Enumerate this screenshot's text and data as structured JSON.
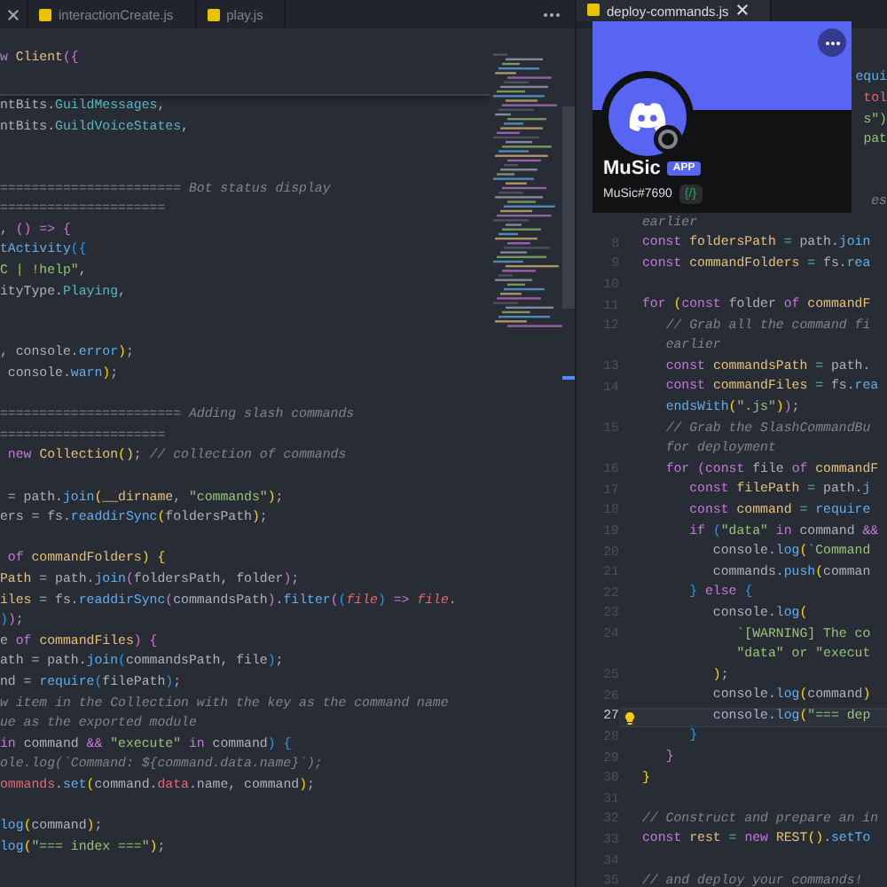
{
  "left_pane": {
    "tabs": [
      {
        "label": "interactionCreate.js",
        "selected": false
      },
      {
        "label": "play.js",
        "selected": false
      }
    ],
    "sticky_line": {
      "tokens": [
        {
          "t": "w ",
          "kind": "kw"
        },
        {
          "t": "Client",
          "kind": "var"
        },
        {
          "t": "({",
          "kind": "b2"
        }
      ]
    },
    "lines": [
      {
        "kind": "code",
        "tokens": [
          {
            "t": "ntBits.",
            "kind": "pl"
          },
          {
            "t": "GuildMessages",
            "kind": "mem"
          },
          {
            "t": ",",
            "kind": "pl"
          }
        ]
      },
      {
        "kind": "code",
        "tokens": [
          {
            "t": "ntBits.",
            "kind": "pl"
          },
          {
            "t": "GuildVoiceStates",
            "kind": "mem"
          },
          {
            "t": ",",
            "kind": "pl"
          }
        ]
      },
      {
        "kind": "blank"
      },
      {
        "kind": "blank"
      },
      {
        "kind": "code",
        "tokens": [
          {
            "t": "======================= Bot status display",
            "kind": "com"
          }
        ]
      },
      {
        "kind": "code",
        "tokens": [
          {
            "t": "=====================",
            "kind": "com"
          }
        ]
      },
      {
        "kind": "code",
        "tokens": [
          {
            "t": ", ",
            "kind": "pl"
          },
          {
            "t": "()",
            "kind": "b2"
          },
          {
            "t": " => ",
            "kind": "kw"
          },
          {
            "t": "{",
            "kind": "b2"
          }
        ]
      },
      {
        "kind": "code",
        "tokens": [
          {
            "t": "tActivity",
            "kind": "fn"
          },
          {
            "t": "({",
            "kind": "b3"
          }
        ]
      },
      {
        "kind": "code",
        "tokens": [
          {
            "t": "C | !help\"",
            "kind": "str"
          },
          {
            "t": ",",
            "kind": "pl"
          }
        ]
      },
      {
        "kind": "code",
        "tokens": [
          {
            "t": "ityType.",
            "kind": "pl"
          },
          {
            "t": "Playing",
            "kind": "mem"
          },
          {
            "t": ",",
            "kind": "pl"
          }
        ]
      },
      {
        "kind": "blank"
      },
      {
        "kind": "blank"
      },
      {
        "kind": "code",
        "tokens": [
          {
            "t": ", console.",
            "kind": "pl"
          },
          {
            "t": "error",
            "kind": "fn"
          },
          {
            "t": ")",
            "kind": "b1"
          },
          {
            "t": ";",
            "kind": "pl"
          }
        ]
      },
      {
        "kind": "code",
        "tokens": [
          {
            "t": " console.",
            "kind": "pl"
          },
          {
            "t": "warn",
            "kind": "fn"
          },
          {
            "t": ")",
            "kind": "b1"
          },
          {
            "t": ";",
            "kind": "pl"
          }
        ]
      },
      {
        "kind": "blank"
      },
      {
        "kind": "code",
        "tokens": [
          {
            "t": "======================= Adding slash commands",
            "kind": "com"
          }
        ]
      },
      {
        "kind": "code",
        "tokens": [
          {
            "t": "=====================",
            "kind": "com"
          }
        ]
      },
      {
        "kind": "code",
        "tokens": [
          {
            "t": " new ",
            "kind": "kw"
          },
          {
            "t": "Collection",
            "kind": "var"
          },
          {
            "t": "()",
            "kind": "b1"
          },
          {
            "t": "; ",
            "kind": "pl"
          },
          {
            "t": "// collection of commands",
            "kind": "com"
          }
        ]
      },
      {
        "kind": "blank"
      },
      {
        "kind": "code",
        "tokens": [
          {
            "t": " = path.",
            "kind": "pl"
          },
          {
            "t": "join",
            "kind": "fn"
          },
          {
            "t": "(",
            "kind": "b1"
          },
          {
            "t": "__dirname",
            "kind": "var"
          },
          {
            "t": ", ",
            "kind": "pl"
          },
          {
            "t": "\"commands\"",
            "kind": "str"
          },
          {
            "t": ")",
            "kind": "b1"
          },
          {
            "t": ";",
            "kind": "pl"
          }
        ]
      },
      {
        "kind": "code",
        "tokens": [
          {
            "t": "ers = fs.",
            "kind": "pl"
          },
          {
            "t": "readdirSync",
            "kind": "fn"
          },
          {
            "t": "(",
            "kind": "b1"
          },
          {
            "t": "foldersPath",
            "kind": "pl"
          },
          {
            "t": ")",
            "kind": "b1"
          },
          {
            "t": ";",
            "kind": "pl"
          }
        ]
      },
      {
        "kind": "blank"
      },
      {
        "kind": "code",
        "tokens": [
          {
            "t": " of ",
            "kind": "kw"
          },
          {
            "t": "commandFolders",
            "kind": "var"
          },
          {
            "t": ") {",
            "kind": "b1"
          }
        ]
      },
      {
        "kind": "code",
        "tokens": [
          {
            "t": "Path",
            "kind": "var"
          },
          {
            "t": " = path.",
            "kind": "pl"
          },
          {
            "t": "join",
            "kind": "fn"
          },
          {
            "t": "(",
            "kind": "b2"
          },
          {
            "t": "foldersPath, folder",
            "kind": "pl"
          },
          {
            "t": ")",
            "kind": "b2"
          },
          {
            "t": ";",
            "kind": "pl"
          }
        ]
      },
      {
        "kind": "code",
        "tokens": [
          {
            "t": "iles",
            "kind": "var"
          },
          {
            "t": " = fs.",
            "kind": "pl"
          },
          {
            "t": "readdirSync",
            "kind": "fn"
          },
          {
            "t": "(",
            "kind": "b2"
          },
          {
            "t": "commandsPath",
            "kind": "pl"
          },
          {
            "t": ")",
            "kind": "b2"
          },
          {
            "t": ".",
            "kind": "pl"
          },
          {
            "t": "filter",
            "kind": "fn"
          },
          {
            "t": "(",
            "kind": "b2"
          },
          {
            "t": "(",
            "kind": "b3"
          },
          {
            "t": "file",
            "kind": "par"
          },
          {
            "t": ")",
            "kind": "b3"
          },
          {
            "t": " => ",
            "kind": "kw"
          },
          {
            "t": "file",
            "kind": "par"
          },
          {
            "t": ".",
            "kind": "pl"
          }
        ]
      },
      {
        "kind": "code",
        "tokens": [
          {
            "t": ")",
            "kind": "b3"
          },
          {
            "t": ")",
            "kind": "b2"
          },
          {
            "t": ";",
            "kind": "pl"
          }
        ]
      },
      {
        "kind": "code",
        "tokens": [
          {
            "t": "e ",
            "kind": "pl"
          },
          {
            "t": "of ",
            "kind": "kw"
          },
          {
            "t": "commandFiles",
            "kind": "var"
          },
          {
            "t": ") {",
            "kind": "b2"
          }
        ]
      },
      {
        "kind": "code",
        "tokens": [
          {
            "t": "ath = path.",
            "kind": "pl"
          },
          {
            "t": "join",
            "kind": "fn"
          },
          {
            "t": "(",
            "kind": "b3"
          },
          {
            "t": "commandsPath, file",
            "kind": "pl"
          },
          {
            "t": ")",
            "kind": "b3"
          },
          {
            "t": ";",
            "kind": "pl"
          }
        ]
      },
      {
        "kind": "code",
        "tokens": [
          {
            "t": "nd = ",
            "kind": "pl"
          },
          {
            "t": "require",
            "kind": "fn"
          },
          {
            "t": "(",
            "kind": "b3"
          },
          {
            "t": "filePath",
            "kind": "pl"
          },
          {
            "t": ")",
            "kind": "b3"
          },
          {
            "t": ";",
            "kind": "pl"
          }
        ]
      },
      {
        "kind": "code",
        "tokens": [
          {
            "t": "w item in the Collection with the key as the command name",
            "kind": "com"
          }
        ]
      },
      {
        "kind": "code",
        "tokens": [
          {
            "t": "ue as the exported module",
            "kind": "com"
          }
        ]
      },
      {
        "kind": "code",
        "tokens": [
          {
            "t": "in ",
            "kind": "kw"
          },
          {
            "t": "command ",
            "kind": "pl"
          },
          {
            "t": "&& ",
            "kind": "kw"
          },
          {
            "t": "\"execute\"",
            "kind": "str"
          },
          {
            "t": " in ",
            "kind": "kw"
          },
          {
            "t": "command",
            "kind": "pl"
          },
          {
            "t": ") {",
            "kind": "b3"
          }
        ]
      },
      {
        "kind": "code",
        "tokens": [
          {
            "t": "ole.log(`Command: ${command.data.name}`);",
            "kind": "com"
          }
        ]
      },
      {
        "kind": "code",
        "tokens": [
          {
            "t": "ommands",
            "kind": "prop"
          },
          {
            "t": ".",
            "kind": "pl"
          },
          {
            "t": "set",
            "kind": "fn"
          },
          {
            "t": "(",
            "kind": "b1"
          },
          {
            "t": "command.",
            "kind": "pl"
          },
          {
            "t": "data",
            "kind": "prop"
          },
          {
            "t": ".name, command",
            "kind": "pl"
          },
          {
            "t": ")",
            "kind": "b1"
          },
          {
            "t": ";",
            "kind": "pl"
          }
        ]
      },
      {
        "kind": "blank"
      },
      {
        "kind": "code",
        "tokens": [
          {
            "t": "log",
            "kind": "fn"
          },
          {
            "t": "(",
            "kind": "b1"
          },
          {
            "t": "command",
            "kind": "pl"
          },
          {
            "t": ")",
            "kind": "b1"
          },
          {
            "t": ";",
            "kind": "pl"
          }
        ]
      },
      {
        "kind": "code",
        "tokens": [
          {
            "t": "log",
            "kind": "fn"
          },
          {
            "t": "(",
            "kind": "b1"
          },
          {
            "t": "\"=== index ===\"",
            "kind": "str"
          },
          {
            "t": ")",
            "kind": "b1"
          },
          {
            "t": ";",
            "kind": "pl"
          }
        ]
      }
    ]
  },
  "right_pane": {
    "tabs": [
      {
        "label": "deploy-commands.js",
        "selected": true
      }
    ],
    "lines": [
      {
        "kind": "covered"
      },
      {
        "kind": "covered"
      },
      {
        "kind": "clipped",
        "tokens": [
          {
            "t": "equi",
            "kind": "fn"
          }
        ]
      },
      {
        "kind": "clipped",
        "tokens": [
          {
            "t": "tol",
            "kind": "prop"
          }
        ]
      },
      {
        "kind": "clipped",
        "tokens": [
          {
            "t": "s\")",
            "kind": "str"
          }
        ]
      },
      {
        "kind": "clipped",
        "tokens": [
          {
            "t": "pat",
            "kind": "str"
          }
        ]
      },
      {
        "kind": "covered"
      },
      {
        "kind": "covered"
      },
      {
        "kind": "clipped",
        "tokens": [
          {
            "t": "es",
            "kind": "com"
          }
        ]
      },
      {
        "kind": "wrap",
        "tokens": [
          {
            "t": "earlier",
            "kind": "com"
          }
        ]
      },
      {
        "kind": "code",
        "number": "8",
        "current": false,
        "tokens": [
          {
            "t": "const ",
            "kind": "kw"
          },
          {
            "t": "foldersPath",
            "kind": "var"
          },
          {
            "t": " = ",
            "kind": "mem"
          },
          {
            "t": "path.",
            "kind": "pl"
          },
          {
            "t": "join",
            "kind": "fn"
          }
        ]
      },
      {
        "kind": "code",
        "number": "9",
        "current": false,
        "tokens": [
          {
            "t": "const ",
            "kind": "kw"
          },
          {
            "t": "commandFolders",
            "kind": "var"
          },
          {
            "t": " = ",
            "kind": "mem"
          },
          {
            "t": "fs.",
            "kind": "pl"
          },
          {
            "t": "rea",
            "kind": "fn"
          }
        ]
      },
      {
        "kind": "blank",
        "number": "10",
        "current": false
      },
      {
        "kind": "code",
        "number": "11",
        "current": false,
        "tokens": [
          {
            "t": "for ",
            "kind": "kw"
          },
          {
            "t": "(",
            "kind": "b1"
          },
          {
            "t": "const ",
            "kind": "kw"
          },
          {
            "t": "folder ",
            "kind": "pl"
          },
          {
            "t": "of ",
            "kind": "kw"
          },
          {
            "t": "commandF",
            "kind": "var"
          }
        ]
      },
      {
        "kind": "code",
        "number": "12",
        "current": false,
        "tokens": [
          {
            "t": "\t// Grab all the command fi",
            "kind": "com"
          }
        ]
      },
      {
        "kind": "wrap",
        "tokens": [
          {
            "t": "\tearlier",
            "kind": "com"
          }
        ]
      },
      {
        "kind": "code",
        "number": "13",
        "current": false,
        "tokens": [
          {
            "t": "\tconst ",
            "kind": "kw"
          },
          {
            "t": "commandsPath",
            "kind": "var"
          },
          {
            "t": " = ",
            "kind": "mem"
          },
          {
            "t": "path.",
            "kind": "pl"
          }
        ]
      },
      {
        "kind": "code",
        "number": "14",
        "current": false,
        "tokens": [
          {
            "t": "\tconst ",
            "kind": "kw"
          },
          {
            "t": "commandFiles",
            "kind": "var"
          },
          {
            "t": " = ",
            "kind": "mem"
          },
          {
            "t": "fs.",
            "kind": "pl"
          },
          {
            "t": "rea",
            "kind": "fn"
          }
        ]
      },
      {
        "kind": "wrap",
        "tokens": [
          {
            "t": "\tendsWith",
            "kind": "fn"
          },
          {
            "t": "(",
            "kind": "b1"
          },
          {
            "t": "\".js\"",
            "kind": "str"
          },
          {
            "t": ")",
            "kind": "b1"
          },
          {
            "t": ")",
            "kind": "b2"
          },
          {
            "t": ";",
            "kind": "pl"
          }
        ]
      },
      {
        "kind": "code",
        "number": "15",
        "current": false,
        "tokens": [
          {
            "t": "\t// Grab the SlashCommandBu",
            "kind": "com"
          }
        ]
      },
      {
        "kind": "wrap",
        "tokens": [
          {
            "t": "\tfor deployment",
            "kind": "com"
          }
        ]
      },
      {
        "kind": "code",
        "number": "16",
        "current": false,
        "tokens": [
          {
            "t": "\tfor ",
            "kind": "kw"
          },
          {
            "t": "(",
            "kind": "b2"
          },
          {
            "t": "const ",
            "kind": "kw"
          },
          {
            "t": "file ",
            "kind": "pl"
          },
          {
            "t": "of ",
            "kind": "kw"
          },
          {
            "t": "commandF",
            "kind": "var"
          }
        ]
      },
      {
        "kind": "code",
        "number": "17",
        "current": false,
        "tokens": [
          {
            "t": "\t\tconst ",
            "kind": "kw"
          },
          {
            "t": "filePath",
            "kind": "var"
          },
          {
            "t": " = ",
            "kind": "mem"
          },
          {
            "t": "path.",
            "kind": "pl"
          },
          {
            "t": "j",
            "kind": "fn"
          }
        ]
      },
      {
        "kind": "code",
        "number": "18",
        "current": false,
        "tokens": [
          {
            "t": "\t\tconst ",
            "kind": "kw"
          },
          {
            "t": "command",
            "kind": "var"
          },
          {
            "t": " = ",
            "kind": "mem"
          },
          {
            "t": "require",
            "kind": "fn"
          }
        ]
      },
      {
        "kind": "code",
        "number": "19",
        "current": false,
        "tokens": [
          {
            "t": "\t\tif ",
            "kind": "kw"
          },
          {
            "t": "(",
            "kind": "b3"
          },
          {
            "t": "\"data\"",
            "kind": "str"
          },
          {
            "t": " in ",
            "kind": "kw"
          },
          {
            "t": "command ",
            "kind": "pl"
          },
          {
            "t": "&&",
            "kind": "kw"
          }
        ]
      },
      {
        "kind": "code",
        "number": "20",
        "current": false,
        "tokens": [
          {
            "t": "\t\t\tconsole.",
            "kind": "pl"
          },
          {
            "t": "log",
            "kind": "fn"
          },
          {
            "t": "(",
            "kind": "b1"
          },
          {
            "t": "`Command",
            "kind": "str"
          }
        ]
      },
      {
        "kind": "code",
        "number": "21",
        "current": false,
        "tokens": [
          {
            "t": "\t\t\tcommands.",
            "kind": "pl"
          },
          {
            "t": "push",
            "kind": "fn"
          },
          {
            "t": "(",
            "kind": "b1"
          },
          {
            "t": "comman",
            "kind": "pl"
          }
        ]
      },
      {
        "kind": "code",
        "number": "22",
        "current": false,
        "tokens": [
          {
            "t": "\t\t}",
            "kind": "b3"
          },
          {
            "t": " else ",
            "kind": "kw"
          },
          {
            "t": "{",
            "kind": "b3"
          }
        ]
      },
      {
        "kind": "code",
        "number": "23",
        "current": false,
        "tokens": [
          {
            "t": "\t\t\tconsole.",
            "kind": "pl"
          },
          {
            "t": "log",
            "kind": "fn"
          },
          {
            "t": "(",
            "kind": "b1"
          }
        ]
      },
      {
        "kind": "code",
        "number": "24",
        "current": false,
        "tokens": [
          {
            "t": "\t\t\t\t`[WARNING] The co",
            "kind": "str"
          }
        ]
      },
      {
        "kind": "wrap",
        "tokens": [
          {
            "t": "\t\t\t\t\"data\" or \"execut",
            "kind": "str"
          }
        ]
      },
      {
        "kind": "code",
        "number": "25",
        "current": false,
        "tokens": [
          {
            "t": "\t\t\t)",
            "kind": "b1"
          },
          {
            "t": ";",
            "kind": "pl"
          }
        ]
      },
      {
        "kind": "code",
        "number": "26",
        "current": false,
        "tokens": [
          {
            "t": "\t\t\tconsole.",
            "kind": "pl"
          },
          {
            "t": "log",
            "kind": "fn"
          },
          {
            "t": "(",
            "kind": "b1"
          },
          {
            "t": "command",
            "kind": "pl"
          },
          {
            "t": ")",
            "kind": "b1"
          }
        ]
      },
      {
        "kind": "code",
        "number": "27",
        "current": true,
        "tokens": [
          {
            "t": "\t\t\tconsole.",
            "kind": "pl"
          },
          {
            "t": "log",
            "kind": "fn"
          },
          {
            "t": "(",
            "kind": "b1"
          },
          {
            "t": "\"=== dep",
            "kind": "str"
          }
        ]
      },
      {
        "kind": "code",
        "number": "28",
        "current": false,
        "tokens": [
          {
            "t": "\t\t}",
            "kind": "b3"
          }
        ]
      },
      {
        "kind": "code",
        "number": "29",
        "current": false,
        "tokens": [
          {
            "t": "\t}",
            "kind": "b2"
          }
        ]
      },
      {
        "kind": "code",
        "number": "30",
        "current": false,
        "tokens": [
          {
            "t": "}",
            "kind": "b1"
          }
        ]
      },
      {
        "kind": "blank",
        "number": "31",
        "current": false
      },
      {
        "kind": "code",
        "number": "32",
        "current": false,
        "tokens": [
          {
            "t": "// Construct and prepare an in",
            "kind": "com"
          }
        ]
      },
      {
        "kind": "code",
        "number": "33",
        "current": false,
        "tokens": [
          {
            "t": "const ",
            "kind": "kw"
          },
          {
            "t": "rest",
            "kind": "var"
          },
          {
            "t": " = ",
            "kind": "mem"
          },
          {
            "t": "new ",
            "kind": "kw"
          },
          {
            "t": "REST",
            "kind": "var"
          },
          {
            "t": "()",
            "kind": "b1"
          },
          {
            "t": ".",
            "kind": "pl"
          },
          {
            "t": "setTo",
            "kind": "fn"
          }
        ]
      },
      {
        "kind": "blank",
        "number": "34",
        "current": false
      },
      {
        "kind": "code",
        "number": "35",
        "current": false,
        "tokens": [
          {
            "t": "// and deploy your commands!",
            "kind": "com"
          }
        ]
      }
    ]
  },
  "profile_card": {
    "name": "MuSic",
    "badge": "APP",
    "tag": "MuSic#7690",
    "command_badge": "{/}"
  }
}
